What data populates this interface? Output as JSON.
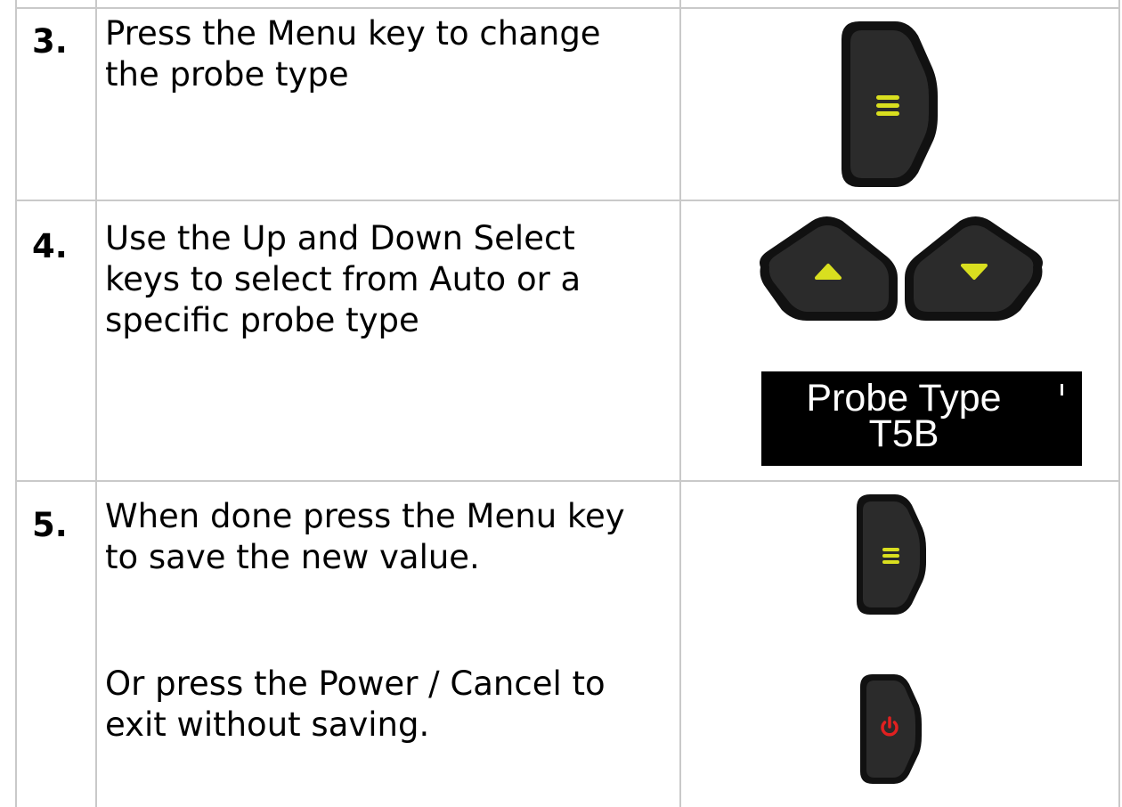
{
  "steps": [
    {
      "number": "3.",
      "lines": [
        "Press the Menu key to change",
        "the probe type"
      ]
    },
    {
      "number": "4.",
      "lines": [
        "Use the Up and Down Select",
        "keys to select from Auto or a",
        "specific probe type"
      ]
    },
    {
      "number": "5.",
      "lines": [
        "When done press the Menu key",
        "to save the new value."
      ],
      "alt_lines": [
        "Or press the Power / Cancel to",
        "exit without saving."
      ]
    }
  ],
  "display": {
    "line1": "Probe Type",
    "line2": "T5B"
  },
  "icons": {
    "menu_key": "menu-key-icon",
    "up_key": "up-select-key-icon",
    "down_key": "down-select-key-icon",
    "power_key": "power-cancel-key-icon"
  },
  "colors": {
    "key_body": "#1e1e1e",
    "menu_glyph": "#d9df1f",
    "power_glyph": "#e02020",
    "grid": "#c9c9c9"
  }
}
